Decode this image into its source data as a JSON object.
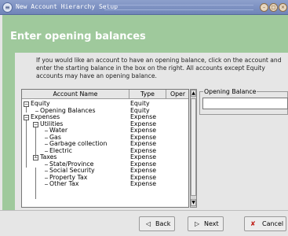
{
  "window": {
    "title": "New Account Hierarchy Setup"
  },
  "icons": {
    "window_menu": "window-menu-icon",
    "minimize": "minimize-icon",
    "maximize": "maximize-icon",
    "close": "close-icon"
  },
  "banner": {
    "title": "Enter opening balances"
  },
  "description": "If you would like an account to have an opening balance, click on the account and enter the starting balance in the box on the right. All accounts except Equity accounts may have an opening balance.",
  "table": {
    "columns": [
      "Account Name",
      "Type",
      "Oper"
    ],
    "rows": [
      {
        "name": "Equity",
        "type": "Equity",
        "level": 0,
        "expander": "−"
      },
      {
        "name": "Opening Balances",
        "type": "Equity",
        "level": 1,
        "expander": ""
      },
      {
        "name": "Expenses",
        "type": "Expense",
        "level": 0,
        "expander": "−"
      },
      {
        "name": "Utilities",
        "type": "Expense",
        "level": 1,
        "expander": "−"
      },
      {
        "name": "Water",
        "type": "Expense",
        "level": 2,
        "expander": ""
      },
      {
        "name": "Gas",
        "type": "Expense",
        "level": 2,
        "expander": ""
      },
      {
        "name": "Garbage collection",
        "type": "Expense",
        "level": 2,
        "expander": ""
      },
      {
        "name": "Electric",
        "type": "Expense",
        "level": 2,
        "expander": ""
      },
      {
        "name": "Taxes",
        "type": "Expense",
        "level": 1,
        "expander": "−"
      },
      {
        "name": "State/Province",
        "type": "Expense",
        "level": 2,
        "expander": ""
      },
      {
        "name": "Social Security",
        "type": "Expense",
        "level": 2,
        "expander": ""
      },
      {
        "name": "Property Tax",
        "type": "Expense",
        "level": 2,
        "expander": ""
      },
      {
        "name": "Other Tax",
        "type": "Expense",
        "level": 2,
        "expander": ""
      }
    ]
  },
  "opening_balance": {
    "label": "Opening Balance",
    "value": ""
  },
  "buttons": {
    "back": "Back",
    "next": "Next",
    "cancel": "Cancel"
  }
}
